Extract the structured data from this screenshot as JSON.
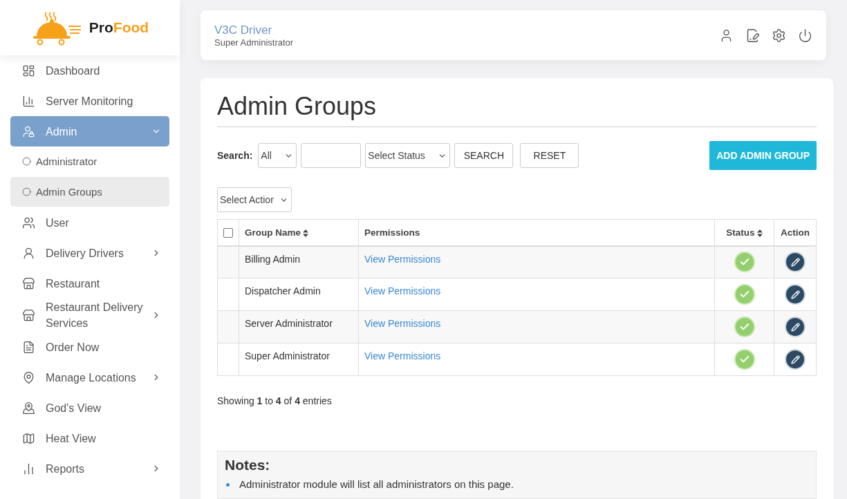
{
  "logo": {
    "brand": [
      "Pro",
      "Food"
    ]
  },
  "sidebar": {
    "items": [
      {
        "label": "Dashboard",
        "selected": false
      },
      {
        "label": "Server Monitoring",
        "selected": false
      },
      {
        "label": "Admin",
        "selected": true,
        "expanded": true,
        "children": [
          {
            "label": "Administrator",
            "selected": false
          },
          {
            "label": "Admin Groups",
            "selected": true
          }
        ]
      },
      {
        "label": "User",
        "selected": false
      },
      {
        "label": "Delivery Drivers",
        "selected": false,
        "expanded": false
      },
      {
        "label": "Restaurant",
        "selected": false
      },
      {
        "label": "Restaurant Delivery Services",
        "selected": false,
        "expanded": false
      },
      {
        "label": "Order Now",
        "selected": false
      },
      {
        "label": "Manage Locations",
        "selected": false,
        "expanded": false
      },
      {
        "label": "God's View",
        "selected": false
      },
      {
        "label": "Heat View",
        "selected": false
      },
      {
        "label": "Reports",
        "selected": false,
        "expanded": false
      }
    ]
  },
  "header": {
    "user_name": "V3C Driver",
    "role": "Super Administrator"
  },
  "page": {
    "title": "Admin Groups",
    "search": {
      "label": "Search:",
      "field_select": "All",
      "status_placeholder": "Select Status",
      "search_button": "SEARCH",
      "reset_button": "RESET"
    },
    "add_button": "ADD ADMIN GROUP",
    "action_select": "Select Actior",
    "table": {
      "select_all_checked": false,
      "columns": [
        "Group Name",
        "Permissions",
        "Status",
        "Action"
      ],
      "rows": [
        {
          "group_name": "Billing Admin",
          "permissions": "View Permissions",
          "active": true
        },
        {
          "group_name": "Dispatcher Admin",
          "permissions": "View Permissions",
          "active": true
        },
        {
          "group_name": "Server Administrator",
          "permissions": "View Permissions",
          "active": true
        },
        {
          "group_name": "Super Administrator",
          "permissions": "View Permissions",
          "active": true
        }
      ]
    },
    "summary": "Showing **1** to **4** of **4** entries",
    "notes": {
      "title": "Notes:",
      "items": [
        "Administrator module will list all administrators on this page."
      ]
    }
  }
}
